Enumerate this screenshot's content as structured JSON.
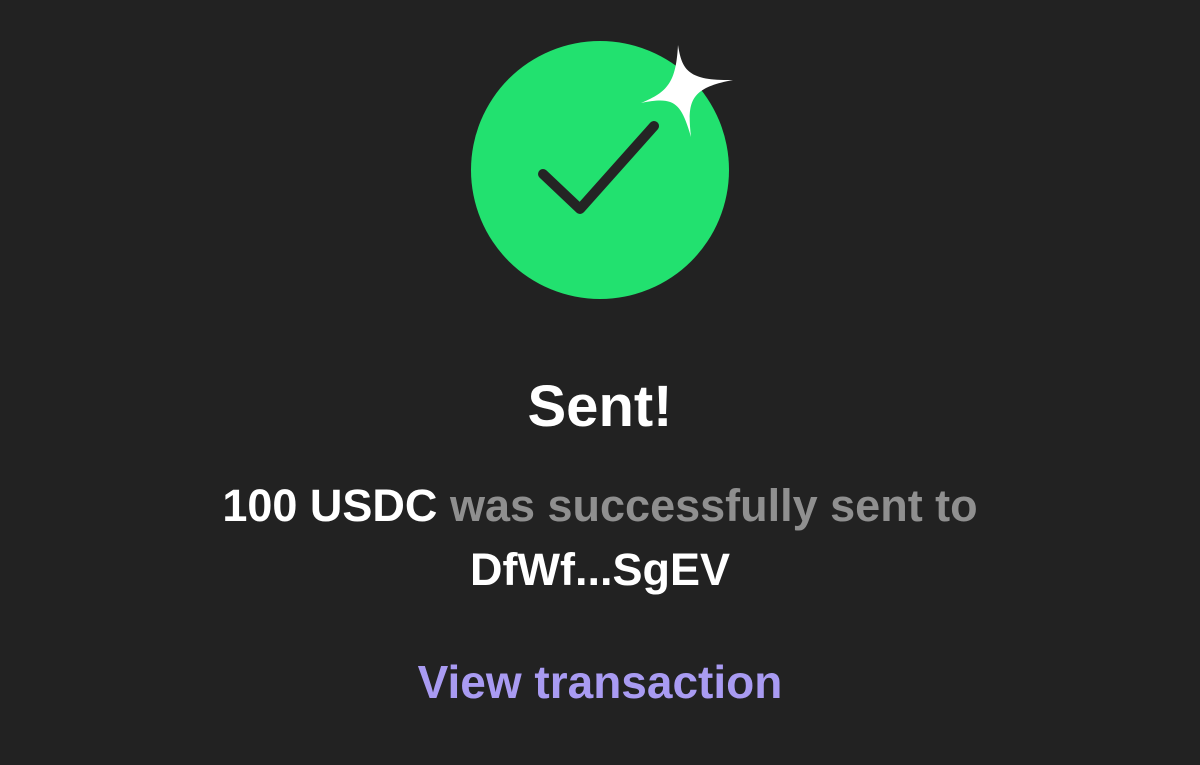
{
  "status": {
    "title": "Sent!",
    "amount": "100 USDC",
    "message": "was successfully sent to",
    "recipient": "DfWf...SgEV"
  },
  "actions": {
    "view_transaction_label": "View transaction"
  },
  "icons": {
    "status": "checkmark-icon",
    "decoration": "sparkle-icon"
  },
  "colors": {
    "background": "#222222",
    "success": "#22e16f",
    "link": "#a99bf2",
    "muted_text": "#8f8f8f"
  }
}
